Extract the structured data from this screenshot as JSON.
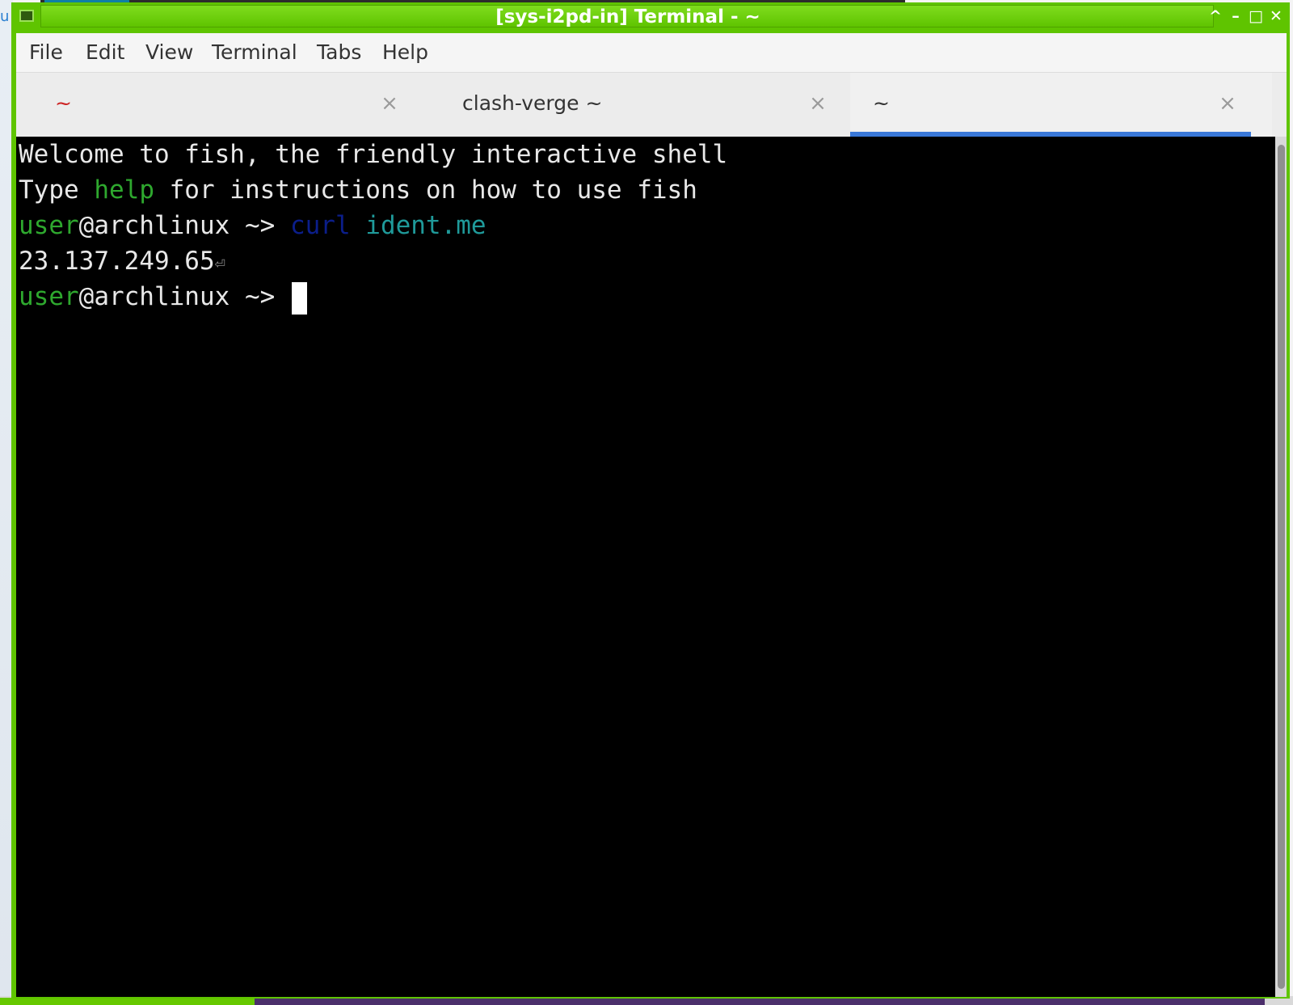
{
  "window": {
    "title": "[sys-i2pd-in] Terminal - ~",
    "controls": {
      "up": "^",
      "minimize": "–",
      "maximize": "□",
      "close": "✕"
    }
  },
  "desktop": {
    "left_fragment": "u"
  },
  "menubar": {
    "items": [
      "File",
      "Edit",
      "View",
      "Terminal",
      "Tabs",
      "Help"
    ]
  },
  "tabs": [
    {
      "label": "~",
      "close": "×",
      "active": false
    },
    {
      "label": "clash-verge ~",
      "close": "×",
      "active": false
    },
    {
      "label": "~",
      "close": "×",
      "active": true
    }
  ],
  "terminal": {
    "welcome": "Welcome to fish, the friendly interactive shell",
    "type_line": {
      "pre": "Type ",
      "help": "help",
      "post": " for instructions on how to use fish"
    },
    "prompt": {
      "user": "user",
      "host": "@archlinux",
      "dir_arrow": " ~> "
    },
    "command": {
      "cmd": "curl",
      "arg": "ident.me"
    },
    "output": "23.137.249.65",
    "return_glyph": "⏎"
  },
  "colors": {
    "titlebar": "#5fc400",
    "terminal_bg": "#000000",
    "prompt_green": "#2ea82e",
    "tab_indicator": "#3a78d8"
  }
}
